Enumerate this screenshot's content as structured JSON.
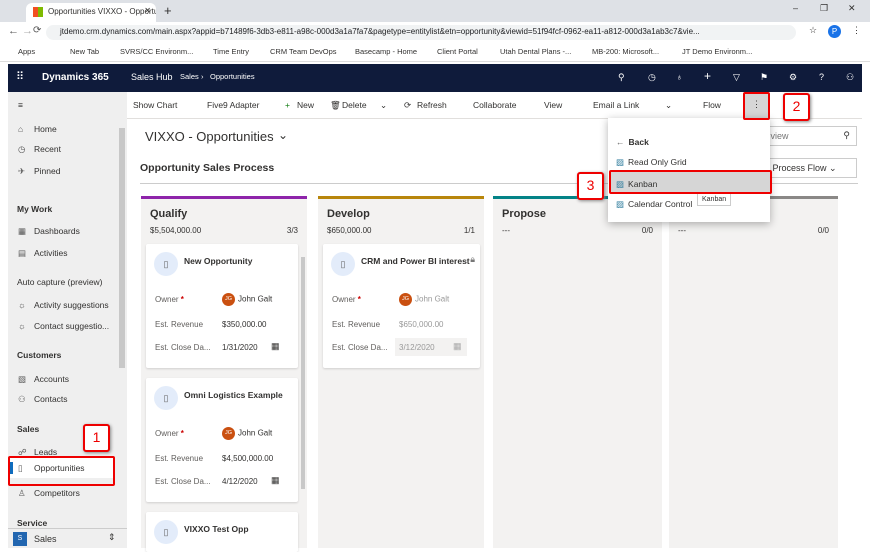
{
  "browser": {
    "tab_title": "Opportunities VIXXO - Opportuni",
    "url": "jtdemo.crm.dynamics.com/main.aspx?appid=b71489f6-3db3-e811-a98c-000d3a1a7fa7&pagetype=entitylist&etn=opportunity&viewid=51f94fcf-0962-ea11-a812-000d3a1ab3c7&vie...",
    "profile": "P",
    "bookmarks": [
      "Apps",
      "New Tab",
      "SVRS/CC Environm...",
      "Time Entry",
      "CRM Team DevOps",
      "Basecamp - Home",
      "Client Portal",
      "Utah Dental Plans -...",
      "MB-200: Microsoft...",
      "JT Demo Environm..."
    ]
  },
  "nav": {
    "app": "Dynamics 365",
    "hub": "Sales Hub",
    "breadcrumb": [
      "Sales",
      "Opportunities"
    ]
  },
  "commands": [
    "Show Chart",
    "Five9 Adapter",
    "New",
    "Delete",
    "Refresh",
    "Collaborate",
    "View",
    "Email a Link",
    "Flow"
  ],
  "sidebar": {
    "home": "Home",
    "recent": "Recent",
    "pinned": "Pinned",
    "my_work": "My Work",
    "dashboards": "Dashboards",
    "activities": "Activities",
    "auto_capture": "Auto capture (preview)",
    "activity_suggestions": "Activity suggestions",
    "contact_suggestions": "Contact suggestio...",
    "customers": "Customers",
    "accounts": "Accounts",
    "contacts": "Contacts",
    "sales": "Sales",
    "leads": "Leads",
    "opportunities": "Opportunities",
    "competitors": "Competitors",
    "service": "Service",
    "area": "Sales",
    "area_badge": "S"
  },
  "main": {
    "view_title": "VIXXO - Opportunities",
    "section_title": "Opportunity Sales Process",
    "search_placeholder": "this view",
    "bpf_select": "iness Process Flow"
  },
  "columns": [
    {
      "name": "Qualify",
      "total": "$5,504,000.00",
      "count": "3/3",
      "color": "#8e24aa"
    },
    {
      "name": "Develop",
      "total": "$650,000.00",
      "count": "1/1",
      "color": "#b8860b"
    },
    {
      "name": "Propose",
      "total": "---",
      "count": "0/0",
      "color": "#038387"
    },
    {
      "name": "",
      "total": "---",
      "count": "0/0",
      "color": "#8a8886"
    }
  ],
  "cards": [
    {
      "title": "New Opportunity",
      "owner_label": "Owner",
      "owner": "John Galt",
      "initials": "JG",
      "rev_label": "Est. Revenue",
      "revenue": "$350,000.00",
      "date_label": "Est. Close Da...",
      "date": "1/31/2020"
    },
    {
      "title": "Omni Logistics Example",
      "owner_label": "Owner",
      "owner": "John Galt",
      "initials": "JG",
      "rev_label": "Est. Revenue",
      "revenue": "$4,500,000.00",
      "date_label": "Est. Close Da...",
      "date": "4/12/2020"
    },
    {
      "title": "VIXXO Test Opp"
    },
    {
      "title": "CRM and Power BI interest",
      "owner_label": "Owner",
      "owner": "John Galt",
      "initials": "JG",
      "rev_label": "Est. Revenue",
      "revenue": "$650,000.00",
      "date_label": "Est. Close Da...",
      "date": "3/12/2020"
    }
  ],
  "menu": {
    "back": "Back",
    "items": [
      "Read Only Grid",
      "Kanban",
      "Calendar Control"
    ],
    "tooltip": "Kanban"
  },
  "annotations": [
    "1",
    "2",
    "3"
  ]
}
